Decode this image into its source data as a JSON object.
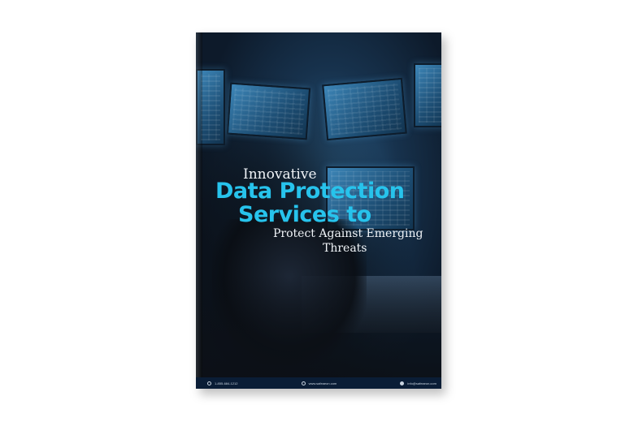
{
  "cover": {
    "title_line1": "Innovative",
    "title_line2": "Data Protection",
    "title_line3": "Services to",
    "title_line4": "Protect Against Emerging",
    "title_line5": "Threats",
    "accent_color": "#27c3ec"
  },
  "footer": {
    "phone": "1-855-684-1212",
    "website": "www.safeaeon.com",
    "email": "info@safeaeon.com",
    "phone_icon": "phone-icon",
    "website_icon": "globe-icon",
    "email_icon": "mail-icon"
  }
}
